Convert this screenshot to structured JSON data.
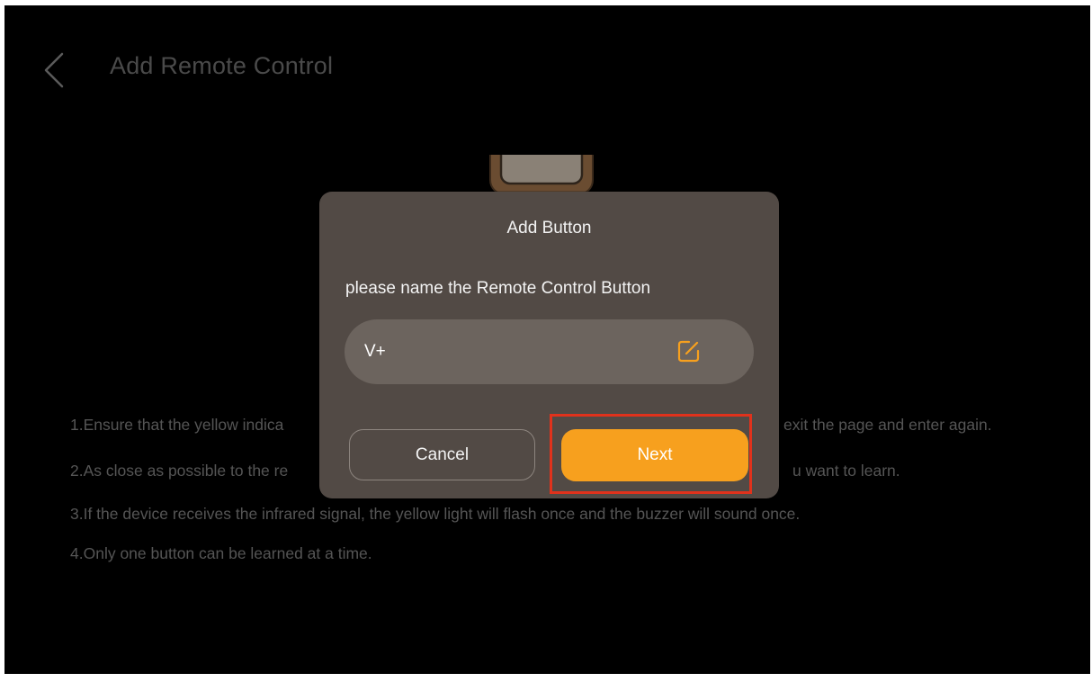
{
  "header": {
    "title": "Add Remote Control"
  },
  "instructions": {
    "line1_left": "1.Ensure that the yellow indica",
    "line1_right": "exit the page and enter again.",
    "line2_left": "2.As close as possible to the re",
    "line2_right": "u want to learn.",
    "line3": "3.If the device receives the infrared signal, the yellow light will flash once and the buzzer will sound once.",
    "line4": "4.Only one button can be learned at a time."
  },
  "dialog": {
    "title": "Add Button",
    "prompt": "please name the Remote Control Button",
    "input_value": "V+",
    "cancel_label": "Cancel",
    "next_label": "Next"
  },
  "colors": {
    "accent": "#f7a01e",
    "dialog_bg": "#524a45",
    "highlight": "#e0321c"
  },
  "icons": [
    "chevron-left-icon",
    "edit-icon"
  ]
}
